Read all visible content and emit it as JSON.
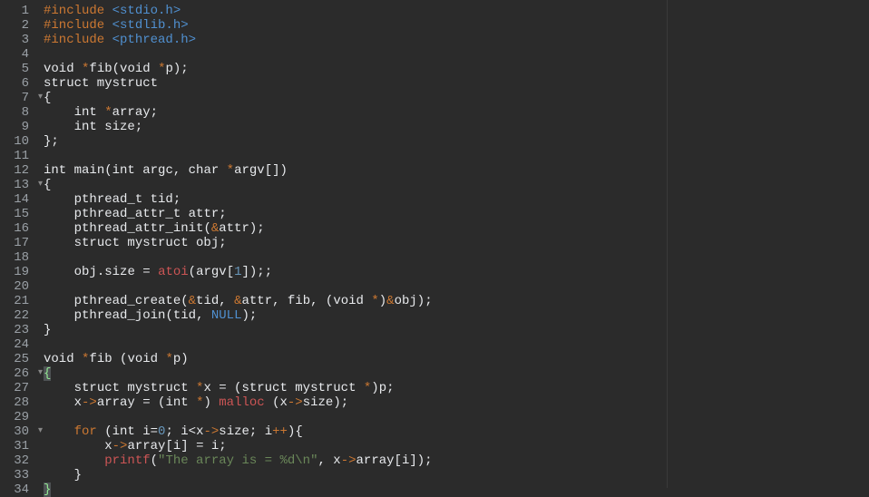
{
  "editor": {
    "line_count": 34,
    "fold_lines": [
      7,
      13,
      26,
      30
    ],
    "lines": [
      [
        {
          "c": "tok-preproc",
          "t": "#include "
        },
        {
          "c": "tok-include",
          "t": "<stdio.h>"
        }
      ],
      [
        {
          "c": "tok-preproc",
          "t": "#include "
        },
        {
          "c": "tok-include",
          "t": "<stdlib.h>"
        }
      ],
      [
        {
          "c": "tok-preproc",
          "t": "#include "
        },
        {
          "c": "tok-include",
          "t": "<pthread.h>"
        }
      ],
      [],
      [
        {
          "c": "tok-type",
          "t": "void "
        },
        {
          "c": "tok-op",
          "t": "*"
        },
        {
          "c": "tok-func",
          "t": "fib"
        },
        {
          "c": "tok-punct",
          "t": "("
        },
        {
          "c": "tok-type",
          "t": "void "
        },
        {
          "c": "tok-op",
          "t": "*"
        },
        {
          "c": "tok-ident",
          "t": "p"
        },
        {
          "c": "tok-punct",
          "t": ");"
        }
      ],
      [
        {
          "c": "tok-type",
          "t": "struct mystruct"
        }
      ],
      [
        {
          "c": "tok-punct",
          "t": "{"
        }
      ],
      [
        {
          "c": "",
          "t": "    "
        },
        {
          "c": "tok-type",
          "t": "int "
        },
        {
          "c": "tok-op",
          "t": "*"
        },
        {
          "c": "tok-ident",
          "t": "array"
        },
        {
          "c": "tok-punct",
          "t": ";"
        }
      ],
      [
        {
          "c": "",
          "t": "    "
        },
        {
          "c": "tok-type",
          "t": "int "
        },
        {
          "c": "tok-ident",
          "t": "size"
        },
        {
          "c": "tok-punct",
          "t": ";"
        }
      ],
      [
        {
          "c": "tok-punct",
          "t": "};"
        }
      ],
      [],
      [
        {
          "c": "tok-type",
          "t": "int "
        },
        {
          "c": "tok-func",
          "t": "main"
        },
        {
          "c": "tok-punct",
          "t": "("
        },
        {
          "c": "tok-type",
          "t": "int "
        },
        {
          "c": "tok-ident",
          "t": "argc"
        },
        {
          "c": "tok-punct",
          "t": ", "
        },
        {
          "c": "tok-type",
          "t": "char "
        },
        {
          "c": "tok-op",
          "t": "*"
        },
        {
          "c": "tok-ident",
          "t": "argv"
        },
        {
          "c": "tok-punct",
          "t": "[])"
        }
      ],
      [
        {
          "c": "tok-punct",
          "t": "{"
        }
      ],
      [
        {
          "c": "",
          "t": "    "
        },
        {
          "c": "tok-type",
          "t": "pthread_t "
        },
        {
          "c": "tok-ident",
          "t": "tid"
        },
        {
          "c": "tok-punct",
          "t": ";"
        }
      ],
      [
        {
          "c": "",
          "t": "    "
        },
        {
          "c": "tok-type",
          "t": "pthread_attr_t "
        },
        {
          "c": "tok-ident",
          "t": "attr"
        },
        {
          "c": "tok-punct",
          "t": ";"
        }
      ],
      [
        {
          "c": "",
          "t": "    "
        },
        {
          "c": "tok-func",
          "t": "pthread_attr_init"
        },
        {
          "c": "tok-punct",
          "t": "("
        },
        {
          "c": "tok-op",
          "t": "&"
        },
        {
          "c": "tok-ident",
          "t": "attr"
        },
        {
          "c": "tok-punct",
          "t": ");"
        }
      ],
      [
        {
          "c": "",
          "t": "    "
        },
        {
          "c": "tok-type",
          "t": "struct mystruct "
        },
        {
          "c": "tok-ident",
          "t": "obj"
        },
        {
          "c": "tok-punct",
          "t": ";"
        }
      ],
      [],
      [
        {
          "c": "",
          "t": "    "
        },
        {
          "c": "tok-ident",
          "t": "obj"
        },
        {
          "c": "tok-punct",
          "t": "."
        },
        {
          "c": "tok-ident",
          "t": "size"
        },
        {
          "c": "tok-punct",
          "t": " = "
        },
        {
          "c": "tok-red",
          "t": "atoi"
        },
        {
          "c": "tok-punct",
          "t": "("
        },
        {
          "c": "tok-ident",
          "t": "argv"
        },
        {
          "c": "tok-punct",
          "t": "["
        },
        {
          "c": "tok-number",
          "t": "1"
        },
        {
          "c": "tok-punct",
          "t": "]);;"
        }
      ],
      [],
      [
        {
          "c": "",
          "t": "    "
        },
        {
          "c": "tok-func",
          "t": "pthread_create"
        },
        {
          "c": "tok-punct",
          "t": "("
        },
        {
          "c": "tok-op",
          "t": "&"
        },
        {
          "c": "tok-ident",
          "t": "tid"
        },
        {
          "c": "tok-punct",
          "t": ", "
        },
        {
          "c": "tok-op",
          "t": "&"
        },
        {
          "c": "tok-ident",
          "t": "attr"
        },
        {
          "c": "tok-punct",
          "t": ", "
        },
        {
          "c": "tok-ident",
          "t": "fib"
        },
        {
          "c": "tok-punct",
          "t": ", ("
        },
        {
          "c": "tok-type",
          "t": "void "
        },
        {
          "c": "tok-op",
          "t": "*"
        },
        {
          "c": "tok-punct",
          "t": ")"
        },
        {
          "c": "tok-op",
          "t": "&"
        },
        {
          "c": "tok-ident",
          "t": "obj"
        },
        {
          "c": "tok-punct",
          "t": ");"
        }
      ],
      [
        {
          "c": "",
          "t": "    "
        },
        {
          "c": "tok-func",
          "t": "pthread_join"
        },
        {
          "c": "tok-punct",
          "t": "("
        },
        {
          "c": "tok-ident",
          "t": "tid"
        },
        {
          "c": "tok-punct",
          "t": ", "
        },
        {
          "c": "tok-null",
          "t": "NULL"
        },
        {
          "c": "tok-punct",
          "t": ");"
        }
      ],
      [
        {
          "c": "tok-punct",
          "t": "}"
        }
      ],
      [],
      [
        {
          "c": "tok-type",
          "t": "void "
        },
        {
          "c": "tok-op",
          "t": "*"
        },
        {
          "c": "tok-func",
          "t": "fib "
        },
        {
          "c": "tok-punct",
          "t": "("
        },
        {
          "c": "tok-type",
          "t": "void "
        },
        {
          "c": "tok-op",
          "t": "*"
        },
        {
          "c": "tok-ident",
          "t": "p"
        },
        {
          "c": "tok-punct",
          "t": ")"
        }
      ],
      [
        {
          "c": "tok-bracket-hl",
          "t": "{"
        }
      ],
      [
        {
          "c": "",
          "t": "    "
        },
        {
          "c": "tok-type",
          "t": "struct mystruct "
        },
        {
          "c": "tok-op",
          "t": "*"
        },
        {
          "c": "tok-ident",
          "t": "x"
        },
        {
          "c": "tok-punct",
          "t": " = ("
        },
        {
          "c": "tok-type",
          "t": "struct mystruct "
        },
        {
          "c": "tok-op",
          "t": "*"
        },
        {
          "c": "tok-punct",
          "t": ")"
        },
        {
          "c": "tok-ident",
          "t": "p"
        },
        {
          "c": "tok-punct",
          "t": ";"
        }
      ],
      [
        {
          "c": "",
          "t": "    "
        },
        {
          "c": "tok-ident",
          "t": "x"
        },
        {
          "c": "tok-op",
          "t": "->"
        },
        {
          "c": "tok-ident",
          "t": "array"
        },
        {
          "c": "tok-punct",
          "t": " = ("
        },
        {
          "c": "tok-type",
          "t": "int "
        },
        {
          "c": "tok-op",
          "t": "*"
        },
        {
          "c": "tok-punct",
          "t": ") "
        },
        {
          "c": "tok-red",
          "t": "malloc "
        },
        {
          "c": "tok-punct",
          "t": "("
        },
        {
          "c": "tok-ident",
          "t": "x"
        },
        {
          "c": "tok-op",
          "t": "->"
        },
        {
          "c": "tok-ident",
          "t": "size"
        },
        {
          "c": "tok-punct",
          "t": ");"
        }
      ],
      [],
      [
        {
          "c": "",
          "t": "    "
        },
        {
          "c": "tok-keyword",
          "t": "for "
        },
        {
          "c": "tok-punct",
          "t": "("
        },
        {
          "c": "tok-type",
          "t": "int "
        },
        {
          "c": "tok-ident",
          "t": "i"
        },
        {
          "c": "tok-punct",
          "t": "="
        },
        {
          "c": "tok-number",
          "t": "0"
        },
        {
          "c": "tok-punct",
          "t": "; "
        },
        {
          "c": "tok-ident",
          "t": "i"
        },
        {
          "c": "tok-punct",
          "t": "<"
        },
        {
          "c": "tok-ident",
          "t": "x"
        },
        {
          "c": "tok-op",
          "t": "->"
        },
        {
          "c": "tok-ident",
          "t": "size"
        },
        {
          "c": "tok-punct",
          "t": "; "
        },
        {
          "c": "tok-ident",
          "t": "i"
        },
        {
          "c": "tok-op",
          "t": "++"
        },
        {
          "c": "tok-punct",
          "t": "){"
        }
      ],
      [
        {
          "c": "",
          "t": "        "
        },
        {
          "c": "tok-ident",
          "t": "x"
        },
        {
          "c": "tok-op",
          "t": "->"
        },
        {
          "c": "tok-ident",
          "t": "array"
        },
        {
          "c": "tok-punct",
          "t": "["
        },
        {
          "c": "tok-ident",
          "t": "i"
        },
        {
          "c": "tok-punct",
          "t": "] = "
        },
        {
          "c": "tok-ident",
          "t": "i"
        },
        {
          "c": "tok-punct",
          "t": ";"
        }
      ],
      [
        {
          "c": "",
          "t": "        "
        },
        {
          "c": "tok-red",
          "t": "printf"
        },
        {
          "c": "tok-punct",
          "t": "("
        },
        {
          "c": "tok-strfmt",
          "t": "\"The array is = %d\\n\""
        },
        {
          "c": "tok-punct",
          "t": ", "
        },
        {
          "c": "tok-ident",
          "t": "x"
        },
        {
          "c": "tok-op",
          "t": "->"
        },
        {
          "c": "tok-ident",
          "t": "array"
        },
        {
          "c": "tok-punct",
          "t": "["
        },
        {
          "c": "tok-ident",
          "t": "i"
        },
        {
          "c": "tok-punct",
          "t": "]);"
        }
      ],
      [
        {
          "c": "",
          "t": "    "
        },
        {
          "c": "tok-punct",
          "t": "}"
        }
      ],
      [
        {
          "c": "tok-bracket-hl",
          "t": "}"
        }
      ]
    ]
  }
}
